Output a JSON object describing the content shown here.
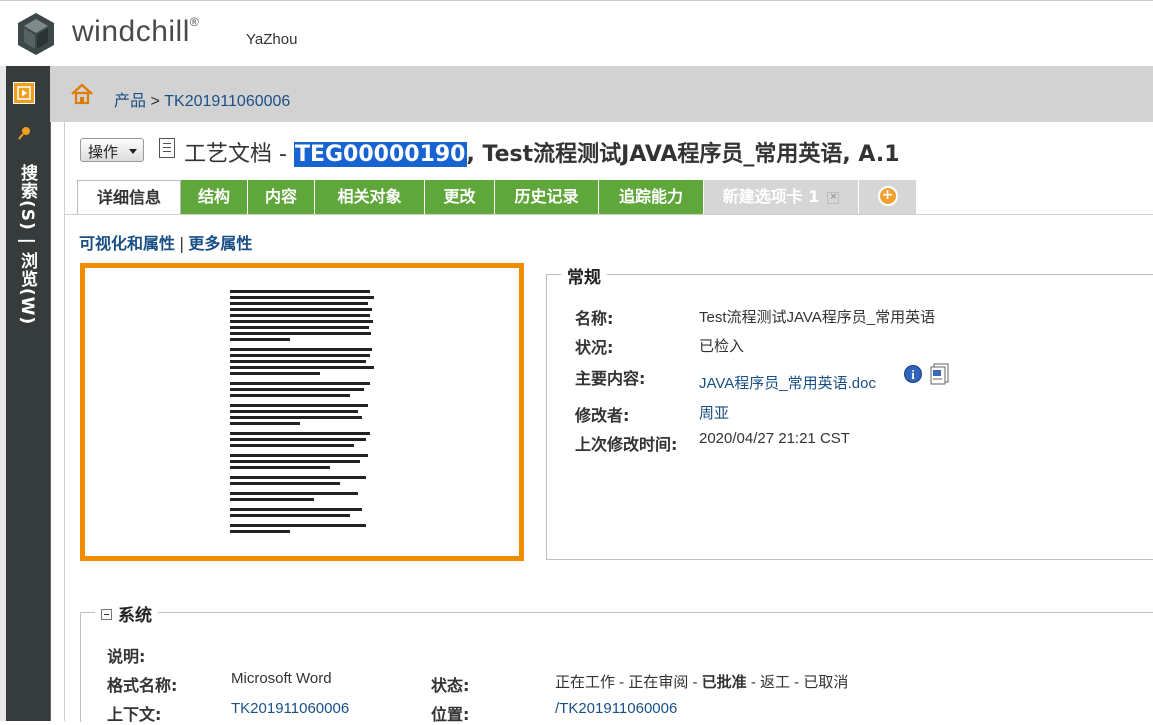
{
  "header": {
    "brand": "windchill",
    "brand_mark": "®",
    "user": "YaZhou"
  },
  "sidebar": {
    "label": "搜索(S) | 浏览(W)"
  },
  "breadcrumb": {
    "root": "产品",
    "separator": ">",
    "current": "TK201911060006"
  },
  "titlebar": {
    "actions_label": "操作",
    "type_prefix": "工艺文档 - ",
    "number": "TEG00000190",
    "rest": ", Test流程测试JAVA程序员_常用英语, A.1"
  },
  "tabs": [
    {
      "label": "详细信息",
      "active": true
    },
    {
      "label": "结构"
    },
    {
      "label": "内容"
    },
    {
      "label": "相关对象"
    },
    {
      "label": "更改"
    },
    {
      "label": "历史记录"
    },
    {
      "label": "追踪能力"
    },
    {
      "label": "新建选项卡 1"
    }
  ],
  "subnav": {
    "visualization": "可视化和属性",
    "more": "更多属性"
  },
  "general": {
    "legend": "常规",
    "fields": [
      {
        "label": "名称:",
        "value": "Test流程测试JAVA程序员_常用英语"
      },
      {
        "label": "状况:",
        "value": "已检入"
      },
      {
        "label": "主要内容:",
        "value": "JAVA程序员_常用英语.doc"
      },
      {
        "label": "修改者:",
        "value": "周亚"
      },
      {
        "label": "上次修改时间:",
        "value": "2020/04/27 21:21 CST"
      }
    ]
  },
  "system": {
    "legend": "系统",
    "desc_label": "说明:",
    "format_label": "格式名称:",
    "format_value": "Microsoft Word",
    "status_label": "状态:",
    "status_seg1": "正在工作 - 正在审阅 - ",
    "status_current": "已批准",
    "status_seg2": " - 返工 - 已取消",
    "context_label": "上下文:",
    "context_value": "TK201911060006",
    "location_label": "位置:",
    "location_value": "/TK201911060006"
  },
  "icons": {
    "logo": "windchill-logo-icon",
    "home": "home-icon",
    "info": "info-icon",
    "word": "word-document-icon"
  },
  "colors": {
    "tab_green": "#5fa73a",
    "accent_orange": "#f08c00",
    "link_blue": "#1a4f86",
    "selection_blue": "#1764d1"
  }
}
